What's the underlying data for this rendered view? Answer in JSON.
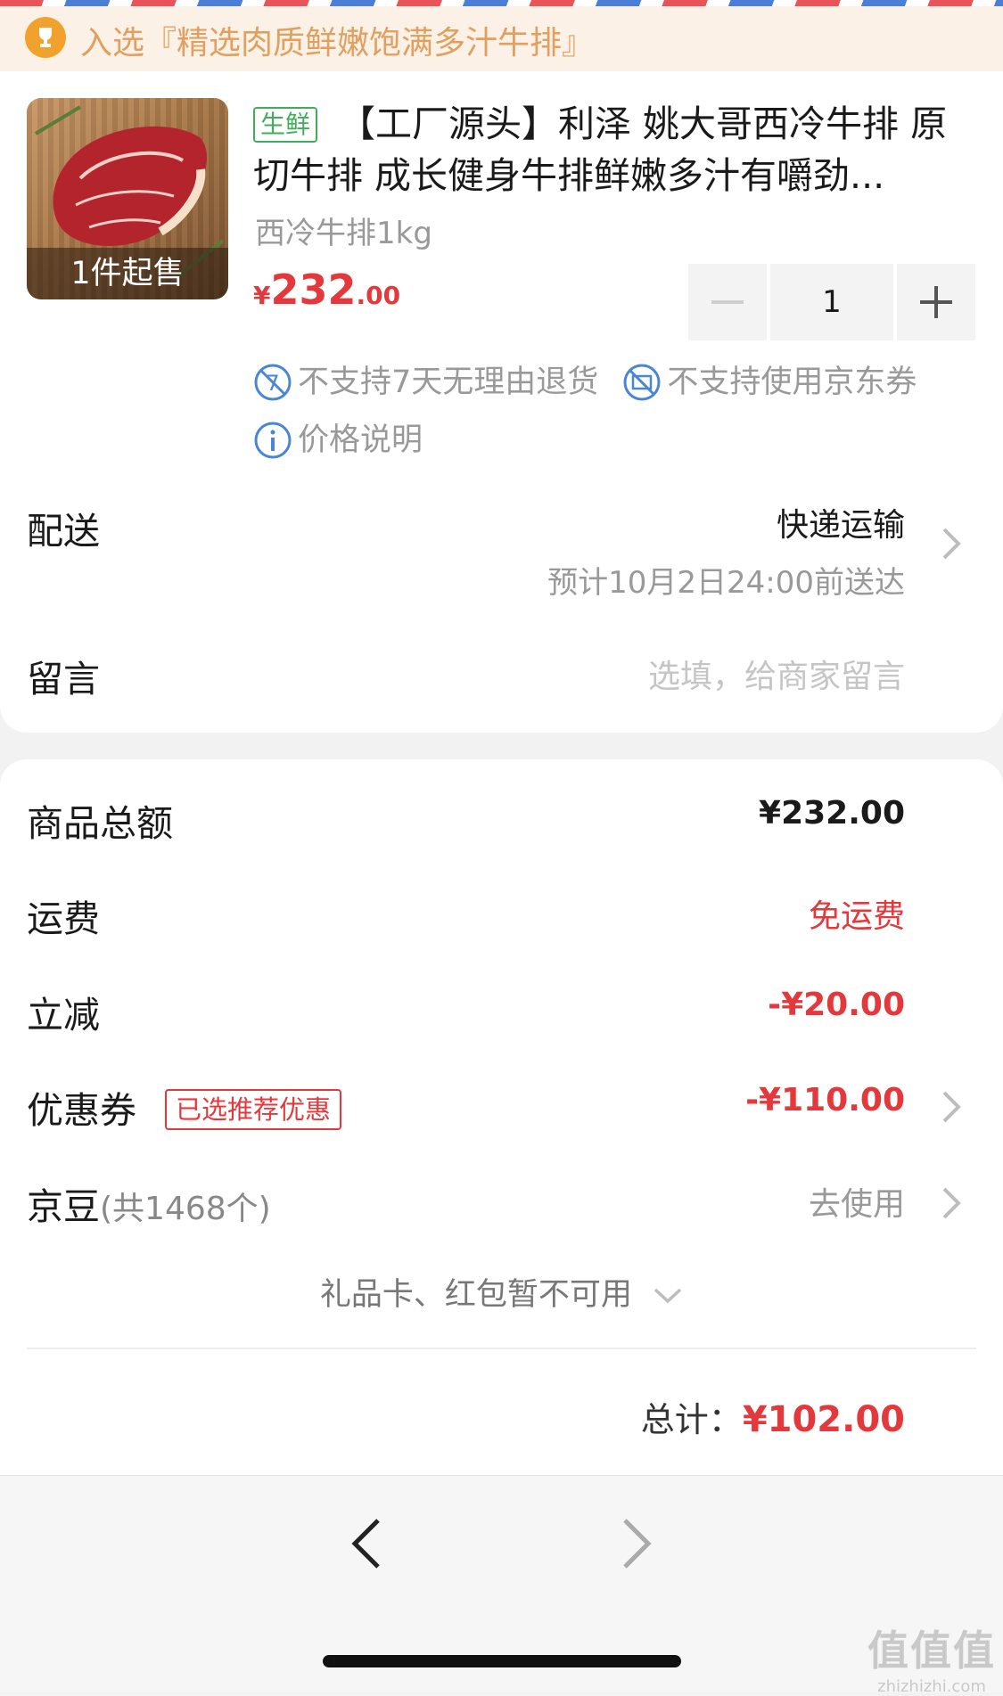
{
  "banner": {
    "text": "入选『精选肉质鲜嫩饱满多汁牛排』",
    "icon": "trophy-icon"
  },
  "product": {
    "tag": "生鲜",
    "title": "【工厂源头】利泽 姚大哥西冷牛排 原切牛排 成长健身牛排鲜嫩多汁有嚼劲...",
    "spec": "西冷牛排1kg",
    "min_order_label": "1件起售",
    "price_symbol": "¥",
    "price_int": "232",
    "price_dec": ".00",
    "quantity": "1",
    "notices": [
      "不支持7天无理由退货",
      "不支持使用京东券",
      "价格说明"
    ]
  },
  "delivery": {
    "label": "配送",
    "method": "快递运输",
    "eta": "预计10月2日24:00前送达"
  },
  "message": {
    "label": "留言",
    "placeholder": "选填，给商家留言"
  },
  "summary": {
    "goods_total_label": "商品总额",
    "goods_total_value": "¥232.00",
    "shipping_label": "运费",
    "shipping_value": "免运费",
    "discount_label": "立减",
    "discount_value": "-¥20.00",
    "coupon_label": "优惠券",
    "coupon_tag": "已选推荐优惠",
    "coupon_value": "-¥110.00",
    "beans_label": "京豆",
    "beans_count": "(共1468个)",
    "beans_action": "去使用",
    "gift_note": "礼品卡、红包暂不可用",
    "total_label": "总计：",
    "total_value": "¥102.00"
  },
  "watermark": {
    "big": "值值值",
    "small": "zhizhizhi.com"
  },
  "colors": {
    "accent_red": "#e4393c",
    "fresh_green": "#3fae5a",
    "banner_bg": "#fcf1e6",
    "banner_text": "#e0a060"
  }
}
